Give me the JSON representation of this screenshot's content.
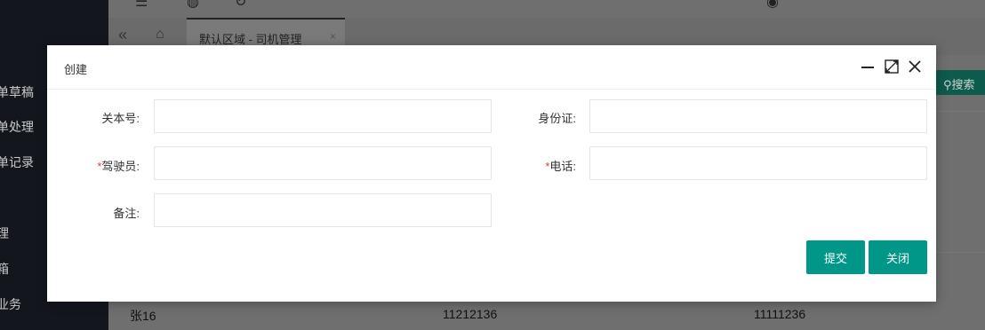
{
  "sidebar": {
    "items": [
      {
        "label": "单草稿"
      },
      {
        "label": "单处理"
      },
      {
        "label": "单记录"
      },
      {
        "label": "理"
      },
      {
        "label": "箱"
      },
      {
        "label": "业务"
      }
    ]
  },
  "tabs": {
    "active_label": "默认区域 - 司机管理",
    "close_glyph": "×"
  },
  "toolbar": {
    "search_label": "搜索"
  },
  "table": {
    "visible_row": [
      "张16",
      "11212136",
      "11111236"
    ]
  },
  "dialog": {
    "title": "创建",
    "fields": {
      "guanbenhao": {
        "label": "关本号:",
        "value": "",
        "required": false
      },
      "id_card": {
        "label": "身份证:",
        "value": "",
        "required": false
      },
      "driver": {
        "label": "驾驶员:",
        "value": "",
        "required": true
      },
      "phone": {
        "label": "电话:",
        "value": "",
        "required": true
      },
      "remark": {
        "label": "备注:",
        "value": "",
        "required": false
      }
    },
    "required_mark": "*",
    "submit_label": "提交",
    "close_label": "关闭"
  },
  "colors": {
    "primary": "#009688",
    "required": "#e4393c"
  }
}
